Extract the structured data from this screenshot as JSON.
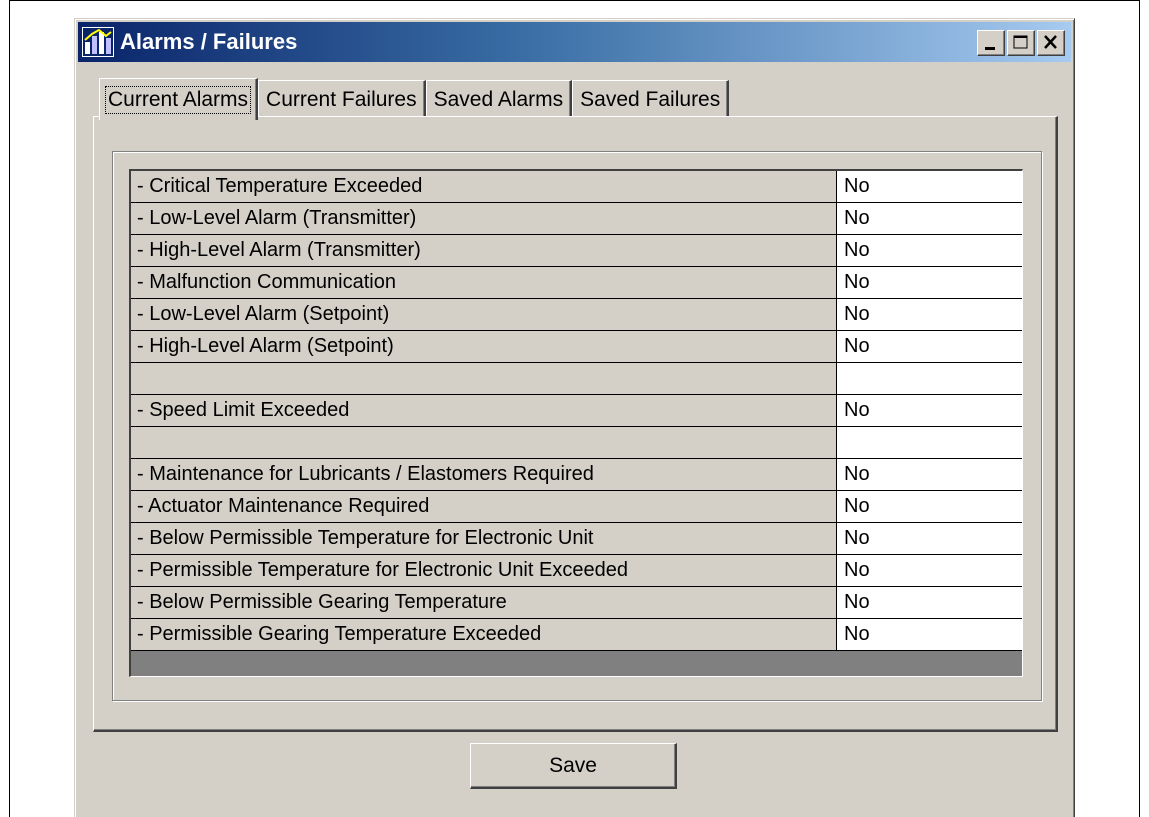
{
  "window": {
    "title": "Alarms / Failures",
    "icon": "app-icon"
  },
  "tabs": [
    {
      "label": "Current Alarms",
      "active": true
    },
    {
      "label": "Current Failures",
      "active": false
    },
    {
      "label": "Saved Alarms",
      "active": false
    },
    {
      "label": "Saved Failures",
      "active": false
    }
  ],
  "alarms": {
    "rows": [
      {
        "label": "-  Critical Temperature Exceeded",
        "value": "No"
      },
      {
        "label": "-  Low-Level Alarm (Transmitter)",
        "value": "No"
      },
      {
        "label": "-  High-Level Alarm (Transmitter)",
        "value": "No"
      },
      {
        "label": "-  Malfunction Communication",
        "value": "No"
      },
      {
        "label": "-  Low-Level Alarm (Setpoint)",
        "value": "No"
      },
      {
        "label": "-  High-Level Alarm (Setpoint)",
        "value": "No"
      },
      {
        "label": "",
        "value": ""
      },
      {
        "label": "-  Speed Limit Exceeded",
        "value": "No"
      },
      {
        "label": "",
        "value": ""
      },
      {
        "label": "-  Maintenance for Lubricants / Elastomers Required",
        "value": "No"
      },
      {
        "label": "-  Actuator Maintenance Required",
        "value": "No"
      },
      {
        "label": "-  Below Permissible Temperature for Electronic Unit",
        "value": "No"
      },
      {
        "label": "-  Permissible Temperature for Electronic Unit Exceeded",
        "value": "No"
      },
      {
        "label": "-  Below Permissible Gearing Temperature",
        "value": "No"
      },
      {
        "label": "-  Permissible Gearing Temperature Exceeded",
        "value": "No"
      }
    ]
  },
  "footer": {
    "save_label": "Save"
  }
}
